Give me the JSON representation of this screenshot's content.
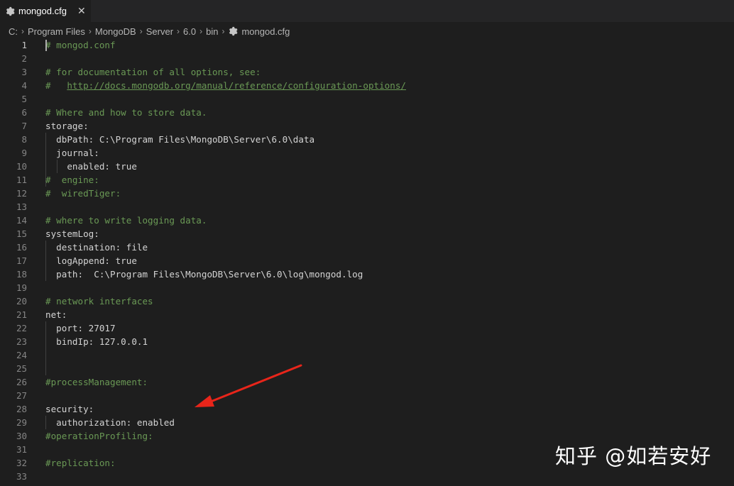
{
  "tab": {
    "title": "mongod.cfg",
    "close_icon": "close-icon"
  },
  "breadcrumb": [
    "C:",
    "Program Files",
    "MongoDB",
    "Server",
    "6.0",
    "bin",
    "mongod.cfg"
  ],
  "lines": [
    {
      "n": "1",
      "text": "# mongod.conf",
      "kind": "comment"
    },
    {
      "n": "2",
      "text": "",
      "kind": "plain"
    },
    {
      "n": "3",
      "text": "# for documentation of all options, see:",
      "kind": "comment"
    },
    {
      "n": "4",
      "text": "#   ",
      "kind": "comment",
      "link": "http://docs.mongodb.org/manual/reference/configuration-options/"
    },
    {
      "n": "5",
      "text": "",
      "kind": "plain"
    },
    {
      "n": "6",
      "text": "# Where and how to store data.",
      "kind": "comment"
    },
    {
      "n": "7",
      "text": "storage:",
      "kind": "plain"
    },
    {
      "n": "8",
      "text": "  dbPath: C:\\Program Files\\MongoDB\\Server\\6.0\\data",
      "kind": "plain"
    },
    {
      "n": "9",
      "text": "  journal:",
      "kind": "plain"
    },
    {
      "n": "10",
      "text": "    enabled: true",
      "kind": "plain"
    },
    {
      "n": "11",
      "text": "#  engine:",
      "kind": "comment"
    },
    {
      "n": "12",
      "text": "#  wiredTiger:",
      "kind": "comment"
    },
    {
      "n": "13",
      "text": "",
      "kind": "plain"
    },
    {
      "n": "14",
      "text": "# where to write logging data.",
      "kind": "comment"
    },
    {
      "n": "15",
      "text": "systemLog:",
      "kind": "plain"
    },
    {
      "n": "16",
      "text": "  destination: file",
      "kind": "plain"
    },
    {
      "n": "17",
      "text": "  logAppend: true",
      "kind": "plain"
    },
    {
      "n": "18",
      "text": "  path:  C:\\Program Files\\MongoDB\\Server\\6.0\\log\\mongod.log",
      "kind": "plain"
    },
    {
      "n": "19",
      "text": "",
      "kind": "plain"
    },
    {
      "n": "20",
      "text": "# network interfaces",
      "kind": "comment"
    },
    {
      "n": "21",
      "text": "net:",
      "kind": "plain"
    },
    {
      "n": "22",
      "text": "  port: 27017",
      "kind": "plain"
    },
    {
      "n": "23",
      "text": "  bindIp: 127.0.0.1",
      "kind": "plain"
    },
    {
      "n": "24",
      "text": "",
      "kind": "plain"
    },
    {
      "n": "25",
      "text": "",
      "kind": "plain"
    },
    {
      "n": "26",
      "text": "#processManagement:",
      "kind": "comment"
    },
    {
      "n": "27",
      "text": "",
      "kind": "plain"
    },
    {
      "n": "28",
      "text": "security:",
      "kind": "plain"
    },
    {
      "n": "29",
      "text": "  authorization: enabled",
      "kind": "plain"
    },
    {
      "n": "30",
      "text": "#operationProfiling:",
      "kind": "comment"
    },
    {
      "n": "31",
      "text": "",
      "kind": "plain"
    },
    {
      "n": "32",
      "text": "#replication:",
      "kind": "comment"
    },
    {
      "n": "33",
      "text": "",
      "kind": "plain"
    }
  ],
  "watermark": "知乎 @如若安好",
  "colors": {
    "comment": "#6a9955",
    "text": "#d4d4d4",
    "background": "#1e1e1e",
    "arrow": "#e8251a"
  }
}
